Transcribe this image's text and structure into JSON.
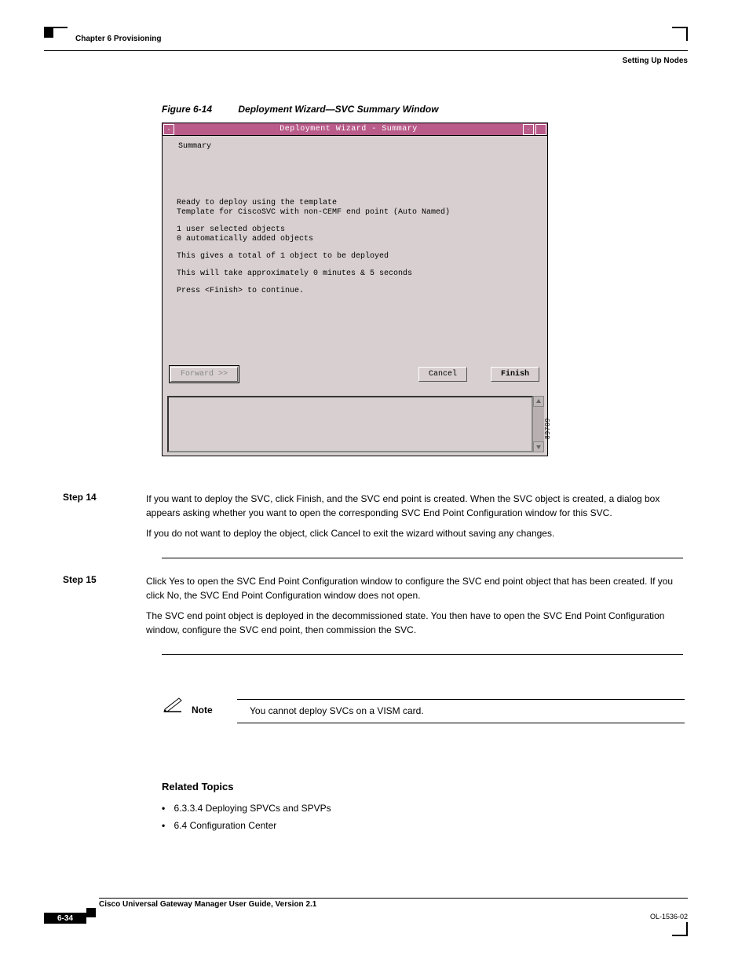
{
  "header": {
    "chapter": "Chapter 6      Provisioning",
    "section": "Setting Up Nodes"
  },
  "figure": {
    "number": "Figure 6-14",
    "title": "Deployment Wizard—SVC Summary Window"
  },
  "dialog": {
    "title": "Deployment Wizard - Summary",
    "summary_label": "Summary",
    "text": {
      "l1": "Ready to deploy using the template",
      "l2": "Template for CiscoSVC with non-CEMF end point (Auto Named)",
      "l3": "1 user selected objects",
      "l4": "0 automatically added objects",
      "l5": "This gives a total of 1 object to be deployed",
      "l6": "This will take approximately 0 minutes & 5 seconds",
      "l7": "Press <Finish> to continue."
    },
    "buttons": {
      "forward": "Forward >>",
      "cancel": "Cancel",
      "finish": "Finish"
    },
    "side_number": "89709"
  },
  "steps": {
    "s14": {
      "label": "Step 14",
      "p1": "If you want to deploy the SVC, click Finish, and the SVC end point is created. When the SVC object is created, a dialog box appears asking whether you want to open the corresponding SVC End Point Configuration window for this SVC.",
      "p2": "If you do not want to deploy the object, click Cancel to exit the wizard without saving any changes."
    },
    "s15": {
      "label": "Step 15",
      "p1": "Click Yes to open the SVC End Point Configuration window to configure the SVC end point object that has been created. If you click No, the SVC End Point Configuration window does not open.",
      "p2": "The SVC end point object is deployed in the decommissioned state. You then have to open the SVC End Point Configuration window, configure the SVC end point, then commission the SVC."
    }
  },
  "note": {
    "label": "Note",
    "text": "You cannot deploy SVCs on a VISM card."
  },
  "related": {
    "heading": "Related Topics",
    "items": [
      "6.3.3.4 Deploying SPVCs and SPVPs",
      "6.4 Configuration Center"
    ]
  },
  "footer": {
    "pagenum": "6-34",
    "doc_title": "Cisco Universal Gateway Manager User Guide, Version 2.1",
    "rev": "OL-1536-02"
  }
}
